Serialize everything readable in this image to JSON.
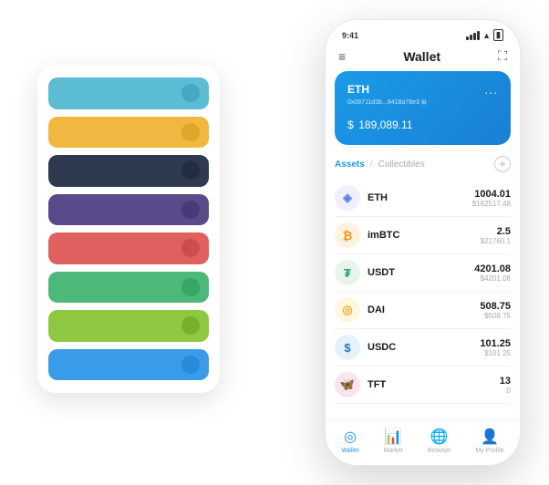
{
  "scene": {
    "bg_card": {
      "strips": [
        {
          "color": "#5bbcd4",
          "dot_color": "#3a9bb8"
        },
        {
          "color": "#f0b840",
          "dot_color": "#d49a20"
        },
        {
          "color": "#2d3a4f",
          "dot_color": "#1a2535"
        },
        {
          "color": "#5a4a8a",
          "dot_color": "#3d2f72"
        },
        {
          "color": "#e06060",
          "dot_color": "#c04040"
        },
        {
          "color": "#4db87a",
          "dot_color": "#2a9a5a"
        },
        {
          "color": "#8dc840",
          "dot_color": "#6aa020"
        },
        {
          "color": "#3a9be8",
          "dot_color": "#1a7fd4"
        }
      ]
    },
    "phone": {
      "status_bar": {
        "time": "9:41",
        "signal": "●●●",
        "wifi": "WiFi",
        "battery": "Battery"
      },
      "header": {
        "menu_icon": "≡",
        "title": "Wallet",
        "scan_icon": "⛶"
      },
      "eth_card": {
        "label": "ETH",
        "dots": "...",
        "address": "0x08711d3b...8418a78e3  ⊞",
        "currency_symbol": "$",
        "amount": "189,089.11"
      },
      "assets": {
        "active_tab": "Assets",
        "separator": "/",
        "inactive_tab": "Collectibles",
        "add_icon": "+"
      },
      "tokens": [
        {
          "name": "ETH",
          "icon_char": "◈",
          "icon_class": "eth-icon",
          "balance": "1004.01",
          "usd": "$162517.48"
        },
        {
          "name": "imBTC",
          "icon_char": "₿",
          "icon_class": "imbtc-icon",
          "balance": "2.5",
          "usd": "$21760.1"
        },
        {
          "name": "USDT",
          "icon_char": "₮",
          "icon_class": "usdt-icon",
          "balance": "4201.08",
          "usd": "$4201.08"
        },
        {
          "name": "DAI",
          "icon_char": "◎",
          "icon_class": "dai-icon",
          "balance": "508.75",
          "usd": "$508.75"
        },
        {
          "name": "USDC",
          "icon_char": "$",
          "icon_class": "usdc-icon",
          "balance": "101.25",
          "usd": "$101.25"
        },
        {
          "name": "TFT",
          "icon_char": "🦋",
          "icon_class": "tft-icon",
          "balance": "13",
          "usd": "0"
        }
      ],
      "nav": [
        {
          "label": "Wallet",
          "icon": "◎",
          "active": true
        },
        {
          "label": "Market",
          "icon": "📈",
          "active": false
        },
        {
          "label": "Browser",
          "icon": "⊕",
          "active": false
        },
        {
          "label": "My Profile",
          "icon": "👤",
          "active": false
        }
      ]
    }
  }
}
